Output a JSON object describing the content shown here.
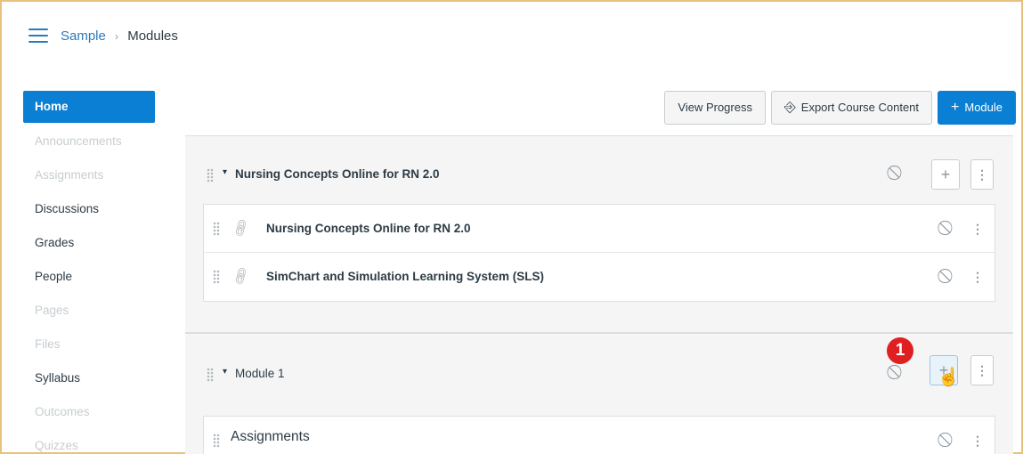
{
  "breadcrumb": {
    "course": "Sample",
    "current": "Modules"
  },
  "sidebar": {
    "items": [
      {
        "label": "Home",
        "state": "active"
      },
      {
        "label": "Announcements",
        "state": "disabled"
      },
      {
        "label": "Assignments",
        "state": "disabled"
      },
      {
        "label": "Discussions",
        "state": "enabled"
      },
      {
        "label": "Grades",
        "state": "enabled"
      },
      {
        "label": "People",
        "state": "enabled"
      },
      {
        "label": "Pages",
        "state": "disabled"
      },
      {
        "label": "Files",
        "state": "disabled"
      },
      {
        "label": "Syllabus",
        "state": "enabled"
      },
      {
        "label": "Outcomes",
        "state": "disabled"
      },
      {
        "label": "Quizzes",
        "state": "disabled"
      }
    ]
  },
  "toolbar": {
    "view_progress": "View Progress",
    "export_content": "Export Course Content",
    "add_module": "Module",
    "add_module_icon": "+",
    "export_icon": "⎆"
  },
  "modules": [
    {
      "title": "Nursing Concepts Online for RN 2.0",
      "items": [
        {
          "title": "Nursing Concepts Online for RN 2.0",
          "icon": "link-icon"
        },
        {
          "title": "SimChart and Simulation Learning System (SLS)",
          "icon": "link-icon"
        }
      ]
    },
    {
      "title": "Module 1",
      "items": [
        {
          "title": "Assignments",
          "icon": "none"
        }
      ]
    }
  ],
  "icons": {
    "plus": "+",
    "kebab": "⋮",
    "unpublished": "⃠",
    "collapse": "▾"
  },
  "annotation": {
    "step": "1"
  },
  "colors": {
    "primary": "#0a7fd3",
    "link": "#2b7abc",
    "badge": "#e02020",
    "frame": "#e8c27a"
  }
}
